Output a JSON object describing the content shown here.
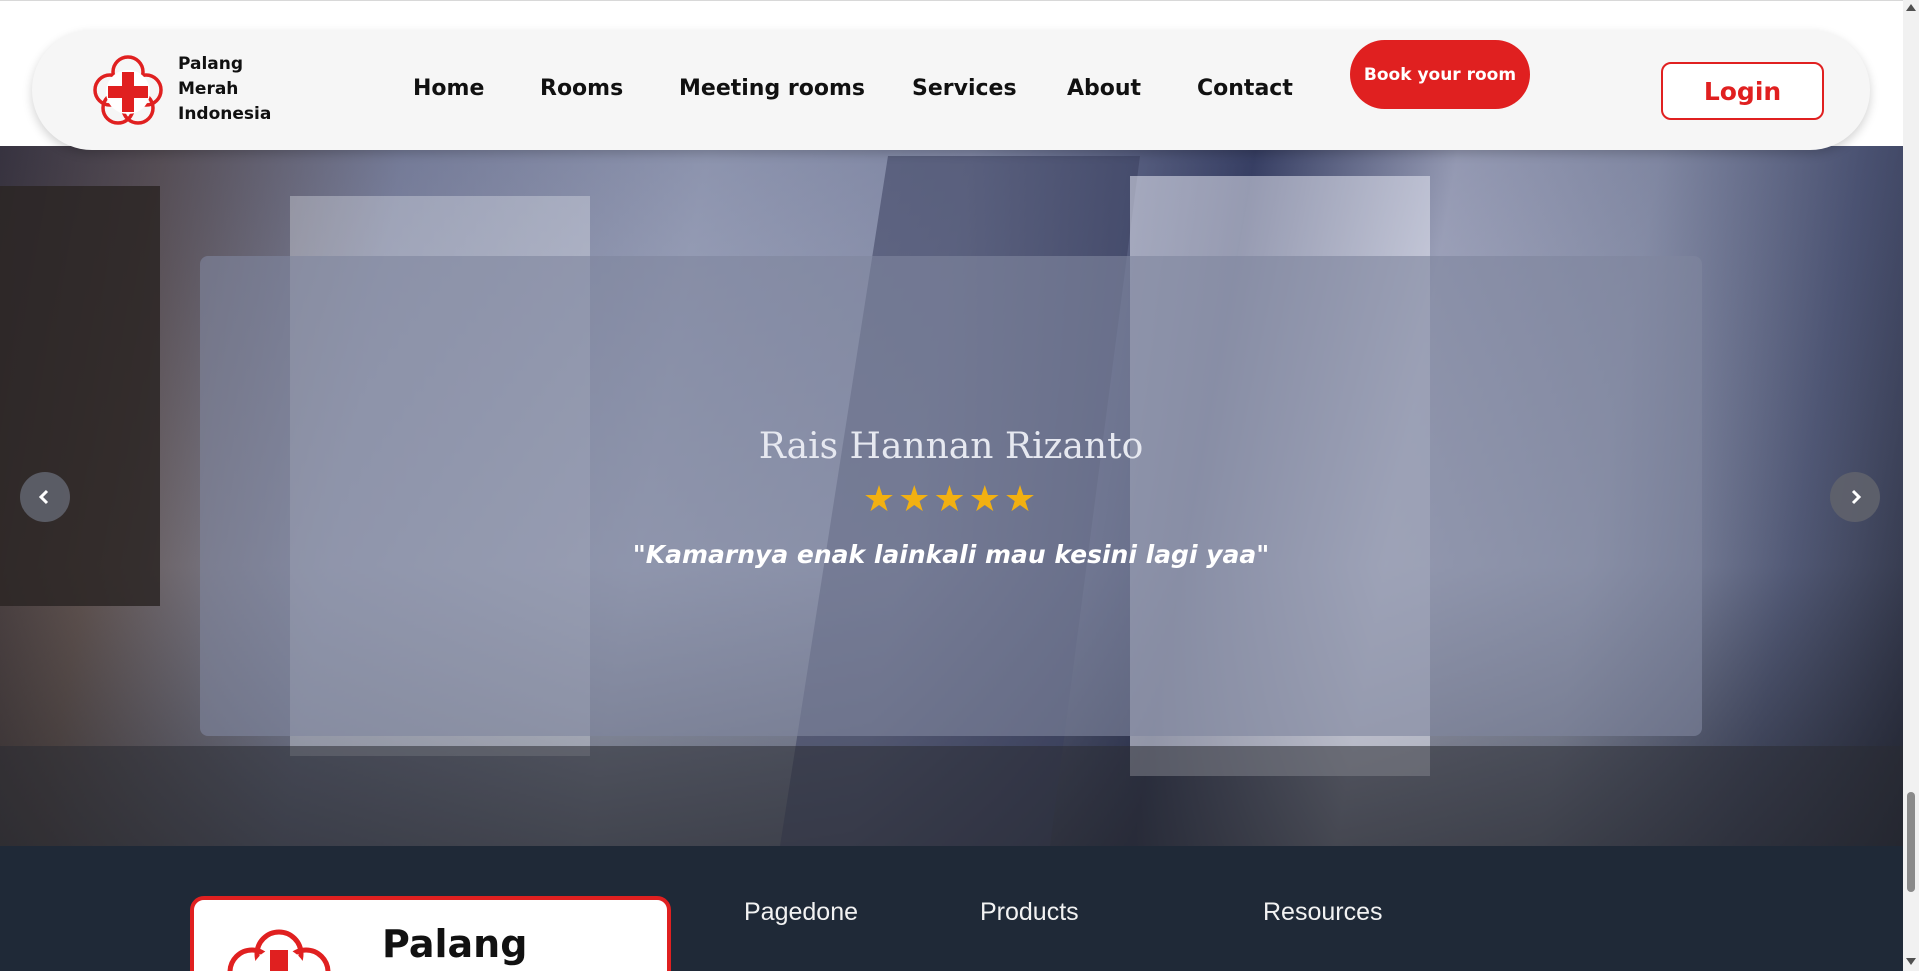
{
  "brand": {
    "name_lines": [
      "Palang",
      "Merah",
      "Indonesia"
    ],
    "logo_icon": "red-cross-flower-icon",
    "accent_color": "#e02020"
  },
  "nav": {
    "items": [
      {
        "label": "Home"
      },
      {
        "label": "Rooms"
      },
      {
        "label": "Meeting rooms"
      },
      {
        "label": "Services"
      },
      {
        "label": "About"
      },
      {
        "label": "Contact"
      }
    ],
    "book_label": "Book your room",
    "login_label": "Login"
  },
  "testimonial": {
    "name": "Rais Hannan Rizanto",
    "rating": 5,
    "rating_max": 5,
    "stars": "★★★★★",
    "quote": "\"Kamarnya enak lainkali mau kesini lagi yaa\"",
    "prev_icon": "chevron-left-icon",
    "next_icon": "chevron-right-icon"
  },
  "footer": {
    "logo_text": "Palang",
    "columns": [
      {
        "title": "Pagedone"
      },
      {
        "title": "Products"
      },
      {
        "title": "Resources"
      }
    ]
  }
}
